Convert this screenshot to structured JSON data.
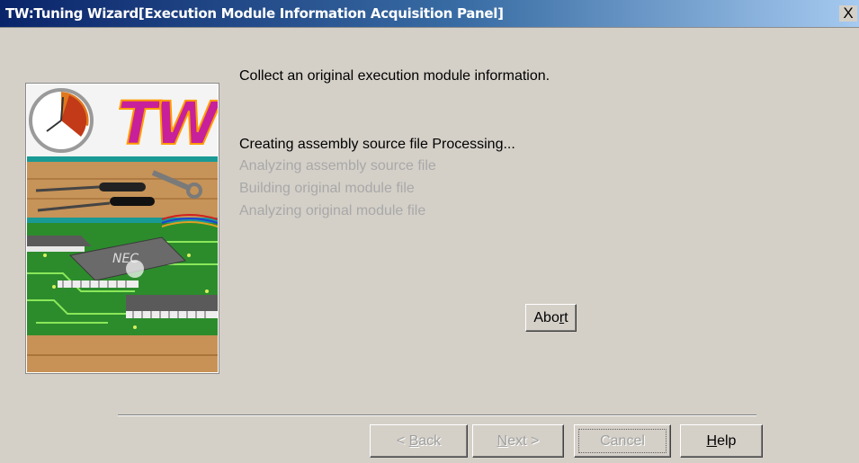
{
  "window": {
    "title": "TW:Tuning Wizard[Execution Module Information Acquisition Panel]",
    "close_symbol": "X"
  },
  "splash": {
    "logo_text": "TW",
    "chip_brand": "NEC",
    "icons": [
      "clock-icon",
      "screwdriver-icon",
      "wrench-icon",
      "chip-icon"
    ]
  },
  "main": {
    "heading": "Collect an original execution module information.",
    "steps": [
      {
        "label": "Creating assembly source file Processing...",
        "state": "active"
      },
      {
        "label": "Analyzing assembly source file",
        "state": "pending"
      },
      {
        "label": "Building original module file",
        "state": "pending"
      },
      {
        "label": "Analyzing original module file",
        "state": "pending"
      }
    ],
    "abort": {
      "before": "Abo",
      "mnemonic": "r",
      "after": "t"
    }
  },
  "footer": {
    "back": {
      "label": "< Back",
      "mnemonic": "B",
      "enabled": false
    },
    "next": {
      "label": "Next >",
      "mnemonic": "N",
      "enabled": false
    },
    "cancel": {
      "label": "Cancel",
      "enabled": false
    },
    "help": {
      "label": "Help",
      "mnemonic": "H",
      "enabled": true
    }
  },
  "colors": {
    "dialog_bg": "#d4d0c8",
    "title_gradient_start": "#0a246a",
    "title_gradient_end": "#a6caf0",
    "disabled_text": "#a8a8a8"
  }
}
